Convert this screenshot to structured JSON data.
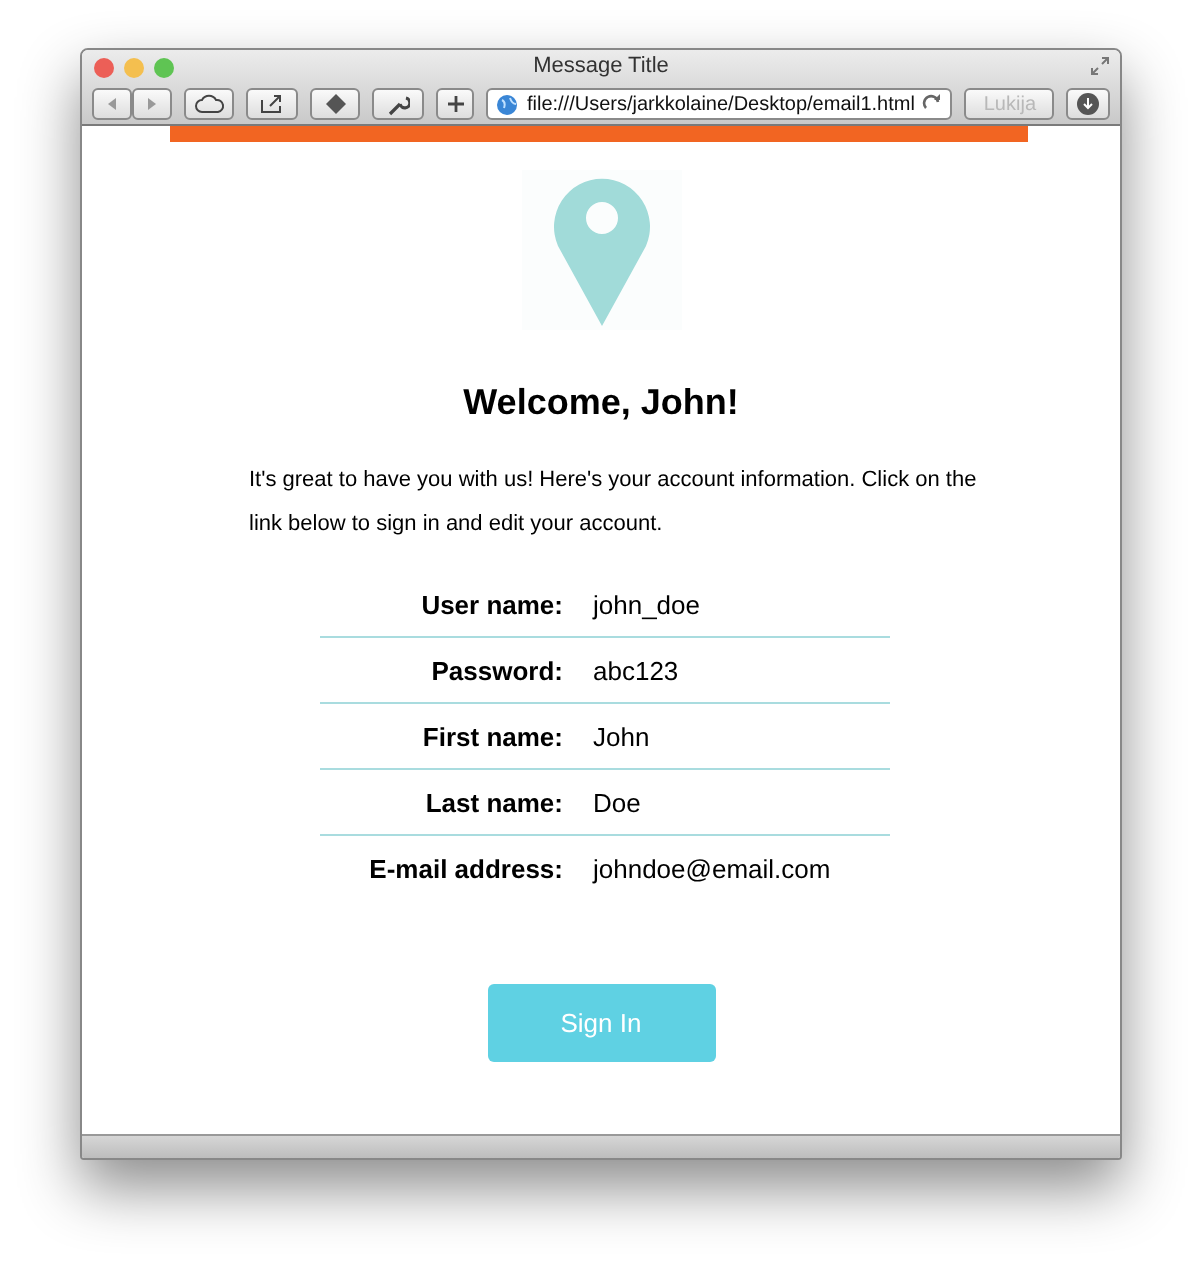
{
  "window": {
    "title": "Message Title",
    "address": "file:///Users/jarkkolaine/Desktop/email1.html",
    "reader_button": {
      "label": "Lukija",
      "disabled": true
    }
  },
  "email": {
    "heading": "Welcome, John!",
    "intro": "It's great to have you with us! Here's your account information. Click on the link below to sign in and edit your account.",
    "fields": [
      {
        "label": "User name:",
        "value": "john_doe"
      },
      {
        "label": "Password:",
        "value": "abc123"
      },
      {
        "label": "First name:",
        "value": "John"
      },
      {
        "label": "Last name:",
        "value": "Doe"
      },
      {
        "label": "E-mail address:",
        "value": "johndoe@email.com"
      }
    ],
    "button": "Sign In"
  }
}
